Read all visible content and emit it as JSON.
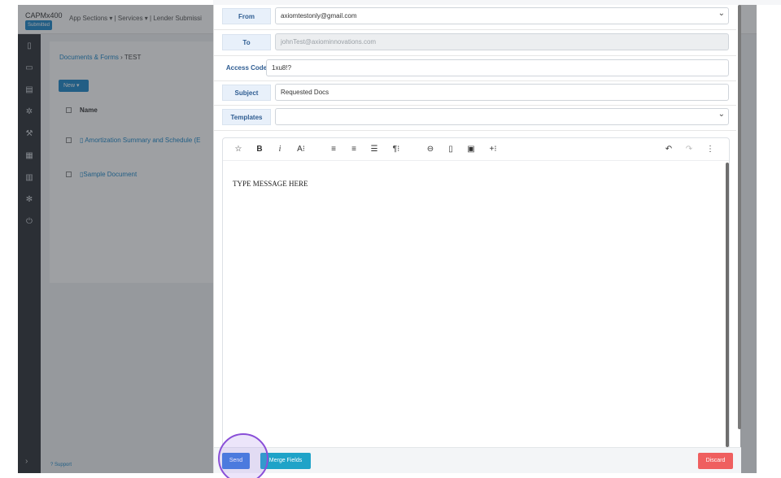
{
  "background_app": {
    "brand": "CAPMx400",
    "status_badge": "Submitted",
    "nav": "App Sections ▾  |  Services ▾  |  Lender Submissi",
    "breadcrumb": {
      "parent": "Documents & Forms",
      "separator": "›",
      "current": "TEST"
    },
    "new_button": "New  ▾",
    "table_header": "Name",
    "rows": [
      "Amortization Summary and Schedule (E",
      "Sample Document"
    ],
    "support": "Support",
    "sidebar_icons": [
      "file-icon",
      "briefcase-icon",
      "table-icon",
      "gears-icon",
      "wrench-icon",
      "grid-icon",
      "bar-chart-icon",
      "cog-icon",
      "power-icon"
    ]
  },
  "email": {
    "from": {
      "label": "From",
      "value": "axiomtestonly@gmail.com"
    },
    "to": {
      "label": "To",
      "placeholder": "johnTest@axiominnovations.com"
    },
    "access_code": {
      "label": "Access Code",
      "value": "1xu8!?"
    },
    "subject": {
      "label": "Subject",
      "value": "Requested Docs"
    },
    "templates": {
      "label": "Templates",
      "value": ""
    },
    "toolbar": {
      "star": "☆",
      "bold": "B",
      "italic": "i",
      "font_size": "A⁝",
      "align_left": "≡",
      "align_center": "≡",
      "list": "☰",
      "paragraph": "¶⁝",
      "link": "⊖",
      "file": "▯",
      "image": "▣",
      "insert": "+⁝",
      "undo": "↶",
      "redo": "↷",
      "more": "⋮"
    },
    "body_text": "TYPE MESSAGE HERE",
    "footer": {
      "send": "Send",
      "merge_fields": "Merge Fields",
      "discard": "Discard"
    }
  },
  "colors": {
    "accent": "#3b7ddd",
    "merge": "#1fa3c8",
    "discard": "#ef5f5f",
    "highlight": "#8a4fd8"
  }
}
